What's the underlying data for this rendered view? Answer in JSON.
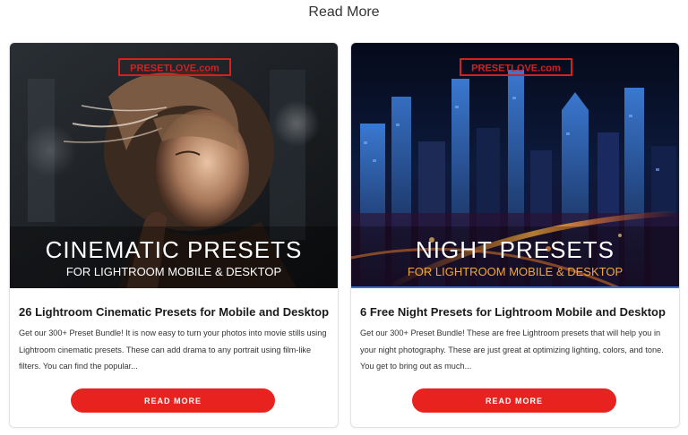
{
  "section": {
    "title": "Read More"
  },
  "cards": [
    {
      "brand": "PRESETLOVE.com",
      "overlay_title": "CINEMATIC PRESETS",
      "overlay_subtitle": "FOR LIGHTROOM MOBILE & DESKTOP",
      "title": "26 Lightroom Cinematic Presets for Mobile and Desktop",
      "excerpt": "Get our 300+ Preset Bundle! It is now easy to turn your photos into movie stills using Lightroom cinematic presets. These can add drama to any portrait using film-like filters. You can find the popular...",
      "button_label": "READ MORE"
    },
    {
      "brand": "PRESETLOVE.com",
      "overlay_title": "NIGHT PRESETS",
      "overlay_subtitle": "FOR LIGHTROOM MOBILE & DESKTOP",
      "title": "6 Free Night Presets for Lightroom Mobile and Desktop",
      "excerpt": "Get our 300+ Preset Bundle! These are free Lightroom presets that will help you in your night photography. These are just great at optimizing lighting, colors, and tone. You get to bring out as much...",
      "button_label": "READ MORE"
    }
  ],
  "colors": {
    "accent": "#e8231f",
    "brand_red": "#d62020",
    "night_subtitle": "#f2a63a"
  }
}
